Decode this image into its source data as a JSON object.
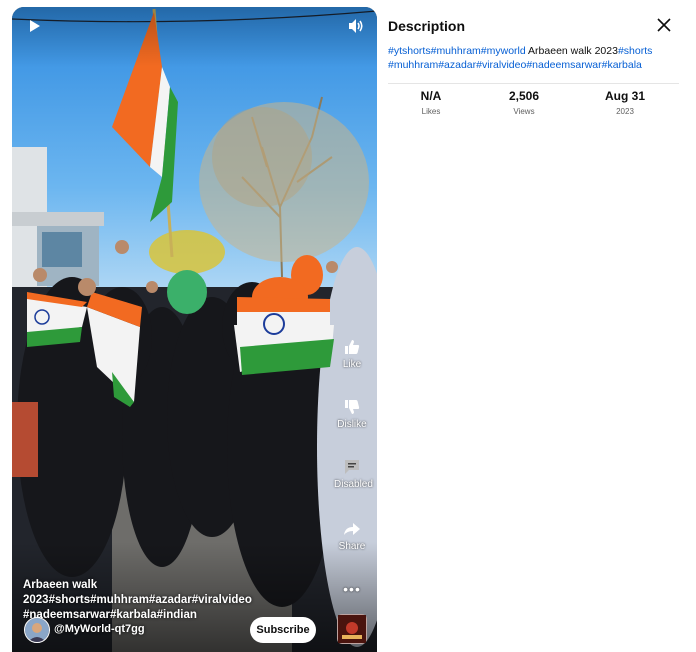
{
  "video": {
    "caption_plain": "Arbaeen walk 2023",
    "caption_tags": "#shorts#muhhram#azadar#viralvideo #nadeemsarwar#karbala#indian",
    "channel": "@MyWorld-qt7gg",
    "subscribe_label": "Subscribe",
    "actions": {
      "like": "Like",
      "dislike": "Dislike",
      "comments": "Disabled",
      "share": "Share",
      "more": "•••"
    }
  },
  "description": {
    "title": "Description",
    "tags_lead": "#ytshorts#muhhram#myworld",
    "text_plain": " Arbaeen walk 2023",
    "tags_after_1": "#shorts",
    "tags_line2": "#muhhram#azadar#viralvideo#nadeemsarwar#karbala",
    "stats": [
      {
        "value": "N/A",
        "label": "Likes"
      },
      {
        "value": "2,506",
        "label": "Views"
      },
      {
        "value": "Aug 31",
        "label": "2023"
      }
    ]
  },
  "colors": {
    "link": "#065fd4",
    "saffron": "#f26a21",
    "green": "#2e9a3a",
    "sky": "#4a9ae6"
  }
}
